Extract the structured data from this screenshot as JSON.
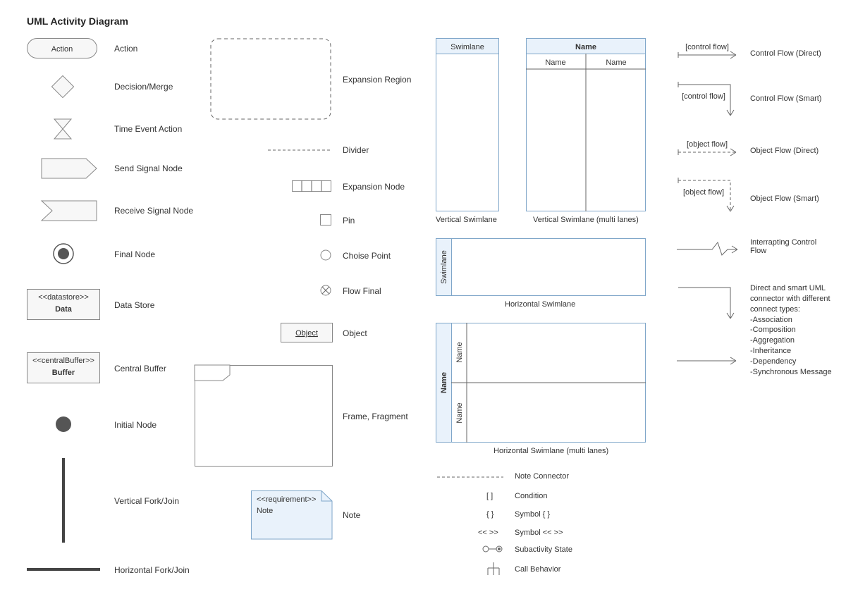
{
  "title": "UML Activity Diagram",
  "col1": {
    "action": {
      "shape_text": "Action",
      "label": "Action"
    },
    "decision": {
      "label": "Decision/Merge"
    },
    "timeevent": {
      "label": "Time Event Action"
    },
    "sendsig": {
      "label": "Send Signal Node"
    },
    "recvsig": {
      "label": "Receive Signal Node"
    },
    "final": {
      "label": "Final Node"
    },
    "datastore": {
      "stereo": "<<datastore>>",
      "text": "Data",
      "label": "Data Store"
    },
    "centralbuf": {
      "stereo": "<<centralBuffer>>",
      "text": "Buffer",
      "label": "Central Buffer"
    },
    "initial": {
      "label": "Initial Node"
    },
    "vfork": {
      "label": "Vertical Fork/Join"
    },
    "hfork": {
      "label": "Horizontal Fork/Join"
    }
  },
  "col2": {
    "expregion": {
      "label": "Expansion Region"
    },
    "divider": {
      "label": "Divider"
    },
    "expnode": {
      "label": "Expansion Node"
    },
    "pin": {
      "label": "Pin"
    },
    "choice": {
      "label": "Choise Point"
    },
    "flowfinal": {
      "label": "Flow Final"
    },
    "object": {
      "shape_text": "Object",
      "label": "Object"
    },
    "frame": {
      "label": "Frame, Fragment"
    },
    "note": {
      "stereo": "<<requirement>>",
      "text": "Note",
      "label": "Note"
    }
  },
  "col3": {
    "vswim": {
      "header": "Swimlane",
      "label": "Vertical Swimlane"
    },
    "vswim_multi": {
      "title": "Name",
      "lane1": "Name",
      "lane2": "Name",
      "label": "Vertical Swimlane (multi lanes)"
    },
    "hswim": {
      "header": "Swimlane",
      "label": "Horizontal Swimlane"
    },
    "hswim_multi": {
      "title": "Name",
      "lane1": "Name",
      "lane2": "Name",
      "label": "Horizontal Swimlane (multi lanes)"
    },
    "notecon": {
      "label": "Note Connector"
    },
    "cond": {
      "symbol": "[  ]",
      "label": "Condition"
    },
    "sym_braces": {
      "symbol": "{  }",
      "label": "Symbol { }"
    },
    "sym_angle": {
      "symbol": "<<  >>",
      "label": "Symbol << >>"
    },
    "subact": {
      "label": "Subactivity State"
    },
    "callbeh": {
      "label": "Call Behavior"
    }
  },
  "col4": {
    "cfd": {
      "tag": "[control flow]",
      "label": "Control Flow (Direct)"
    },
    "cfs": {
      "tag": "[control flow]",
      "label": "Control Flow (Smart)"
    },
    "ofd": {
      "tag": "[object flow]",
      "label": "Object Flow (Direct)"
    },
    "ofs": {
      "tag": "[object flow]",
      "label": "Object Flow (Smart)"
    },
    "icf": {
      "label": "Interrapting Control Flow"
    },
    "umlcon": {
      "text": "Direct and smart UML connector with different connect types:",
      "items": [
        "-Association",
        "-Composition",
        "-Aggregation",
        "-Inheritance",
        "-Dependency",
        "-Synchronous Message"
      ]
    }
  }
}
